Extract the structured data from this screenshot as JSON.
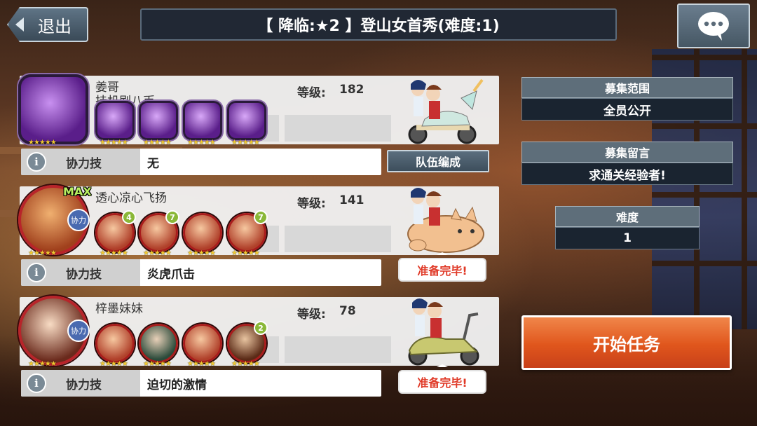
{
  "header": {
    "exit_label": "退出",
    "title": "【 降临:★2 】登山女首秀(难度:1)"
  },
  "players": [
    {
      "name": "姜哥",
      "subtitle": "挂机刷八币",
      "level_label": "等级:",
      "level": "182",
      "skill_label": "协力技",
      "skill": "无",
      "status": ""
    },
    {
      "name": "透心凉心飞扬",
      "subtitle": "",
      "level_label": "等级:",
      "level": "141",
      "skill_label": "协力技",
      "skill": "炎虎爪击",
      "status": "准备完毕!",
      "max_tag": "MAX",
      "coop_tag": "协力",
      "unit_badges": [
        "4",
        "7",
        "",
        "7"
      ]
    },
    {
      "name": "梓墨妹妹",
      "subtitle": "",
      "level_label": "等级:",
      "level": "78",
      "skill_label": "协力技",
      "skill": "迫切的激情",
      "status": "准备完毕!",
      "coop_tag": "协力",
      "unit_badges": [
        "",
        "",
        "",
        "2"
      ]
    }
  ],
  "team_button": "队伍编成",
  "recruit": {
    "range_label": "募集范围",
    "range_value": "全员公开",
    "message_label": "募集留言",
    "message_value": "求通关经验者!",
    "difficulty_label": "难度",
    "difficulty_value": "1"
  },
  "start_button": "开始任务",
  "info_icon": "i",
  "colors": {
    "accent_orange": "#e0561c",
    "ready_red": "#e03a28",
    "panel_slate": "#5e6e7a"
  }
}
